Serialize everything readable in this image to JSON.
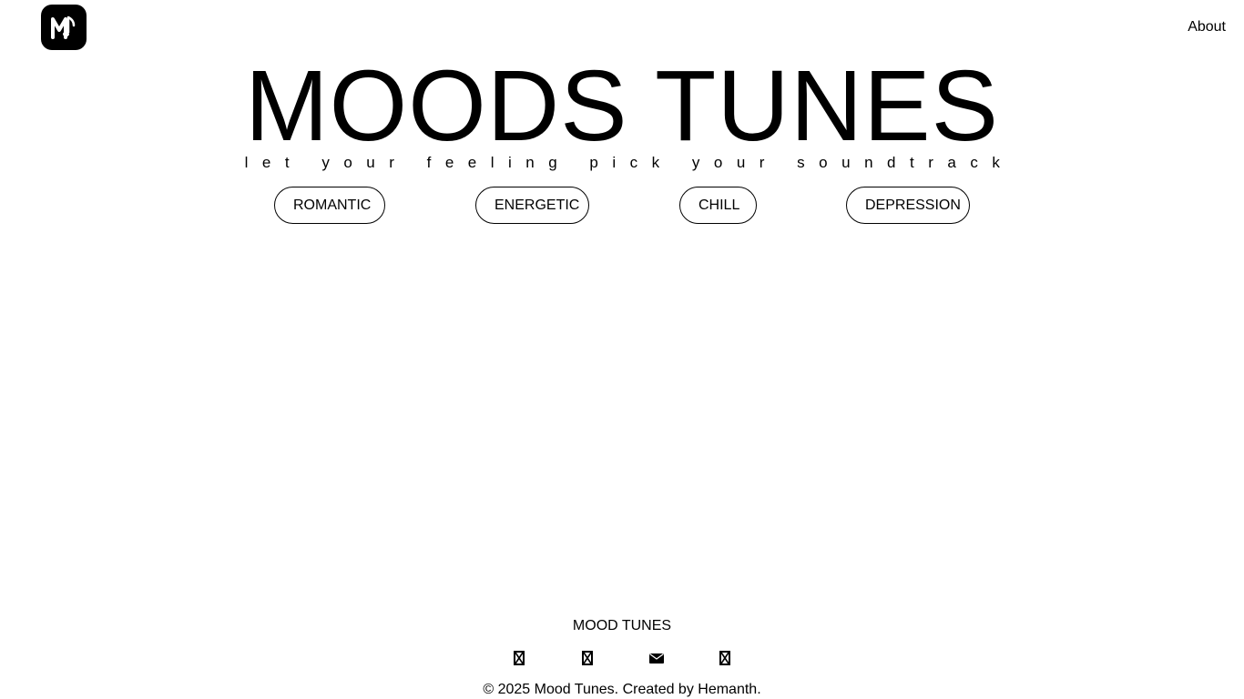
{
  "header": {
    "logo_icon": "music-note-m-logo",
    "about_label": "About"
  },
  "hero": {
    "title": "MOODS TUNES",
    "tagline": "let your feeling pick your soundtrack"
  },
  "moods": [
    {
      "label": "ROMANTIC"
    },
    {
      "label": "ENERGETIC"
    },
    {
      "label": "CHILL"
    },
    {
      "label": "DEPRESSION"
    }
  ],
  "footer": {
    "title": "MOOD TUNES",
    "social_icons": [
      "missing-glyph-icon",
      "missing-glyph-icon",
      "envelope-icon",
      "missing-glyph-icon"
    ],
    "copyright": "© 2025 Mood Tunes. Created by Hemanth."
  },
  "colors": {
    "background": "#ffffff",
    "foreground": "#000000"
  }
}
